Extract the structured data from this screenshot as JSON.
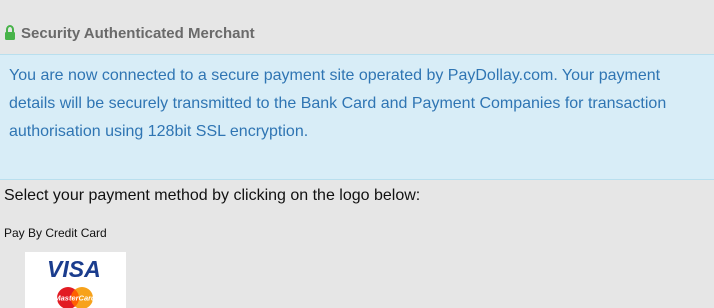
{
  "banner": {
    "fragment": "",
    "tail": ""
  },
  "security": {
    "title": "Security Authenticated Merchant",
    "message": "You are now connected to a secure payment site operated by PayDollay.com. Your payment details will be securely transmitted to the Bank Card and Payment Companies for transaction authorisation using 128bit SSL encryption."
  },
  "payment": {
    "instruction": "Select your payment method by clicking on the logo below:",
    "method_label": "Pay By Credit Card",
    "card_logo": {
      "primary_text": "VISA",
      "secondary_text": "MasterCard"
    }
  },
  "colors": {
    "background": "#e6e6e6",
    "alert_background": "#d8edf7",
    "alert_text": "#2f75b3",
    "lock": "#48b34a",
    "visa_blue": "#1a3c8d",
    "mastercard_red": "#e21b23",
    "mastercard_orange": "#f7a21b"
  },
  "icons": {
    "security": "lock-icon",
    "payment_method": "visa-mastercard-logo"
  }
}
